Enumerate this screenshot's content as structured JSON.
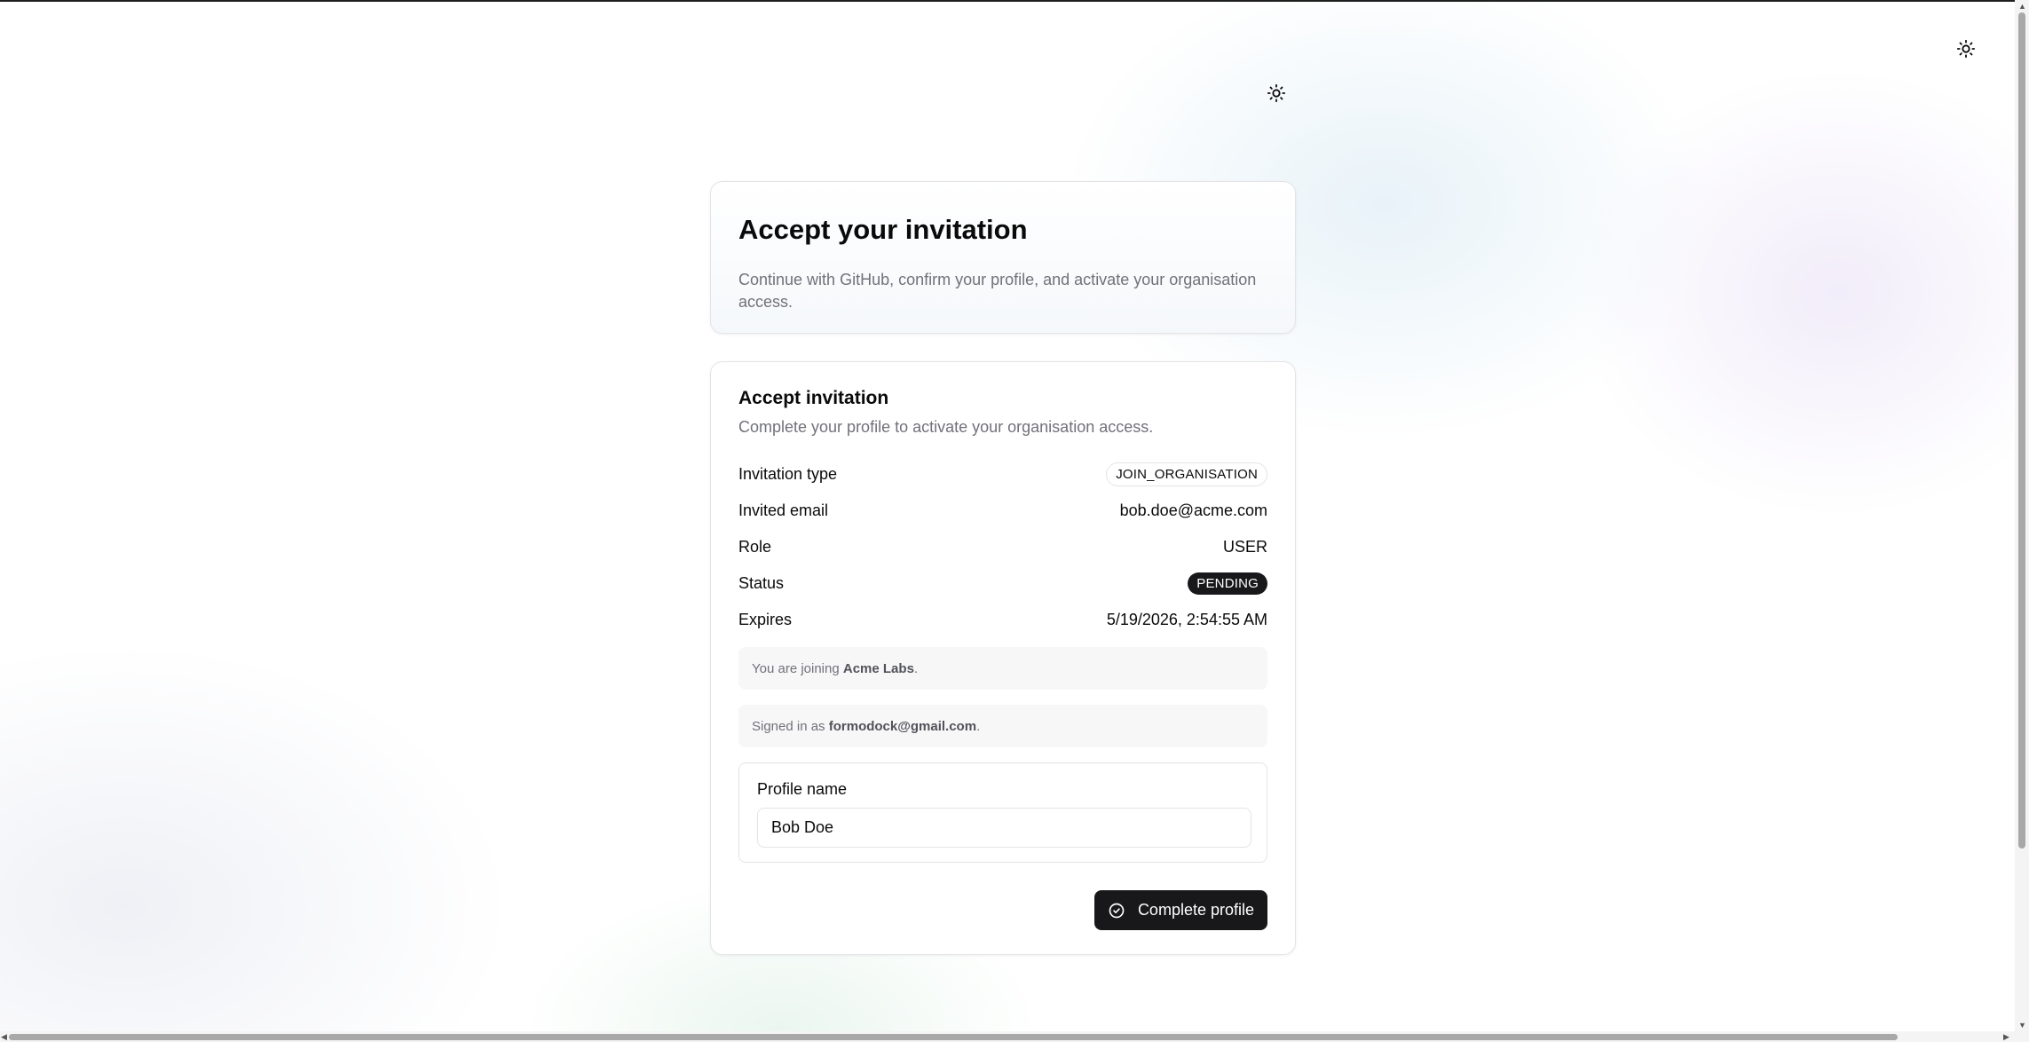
{
  "theme_toggle": {
    "icon": "sun-icon"
  },
  "hero": {
    "title": "Accept your invitation",
    "description": "Continue with GitHub, confirm your profile, and activate your organisation access."
  },
  "invitation": {
    "title": "Accept invitation",
    "description": "Complete your profile to activate your organisation access.",
    "rows": [
      {
        "label": "Invitation type",
        "value": "JOIN_ORGANISATION"
      },
      {
        "label": "Invited email",
        "value": "bob.doe@acme.com"
      },
      {
        "label": "Role",
        "value": "USER"
      },
      {
        "label": "Status",
        "value": "PENDING"
      },
      {
        "label": "Expires",
        "value": "5/19/2026, 2:54:55 AM"
      }
    ],
    "joining": {
      "prefix": "You are joining ",
      "org": "Acme Labs",
      "suffix": "."
    },
    "signed_in": {
      "prefix": "Signed in as ",
      "email": "formodock@gmail.com",
      "suffix": "."
    },
    "profile": {
      "label": "Profile name",
      "value": "Bob Doe"
    },
    "submit_label": "Complete profile"
  },
  "colors": {
    "primary": "#18181b",
    "muted_text": "#71717a",
    "border": "#e4e4e7"
  }
}
